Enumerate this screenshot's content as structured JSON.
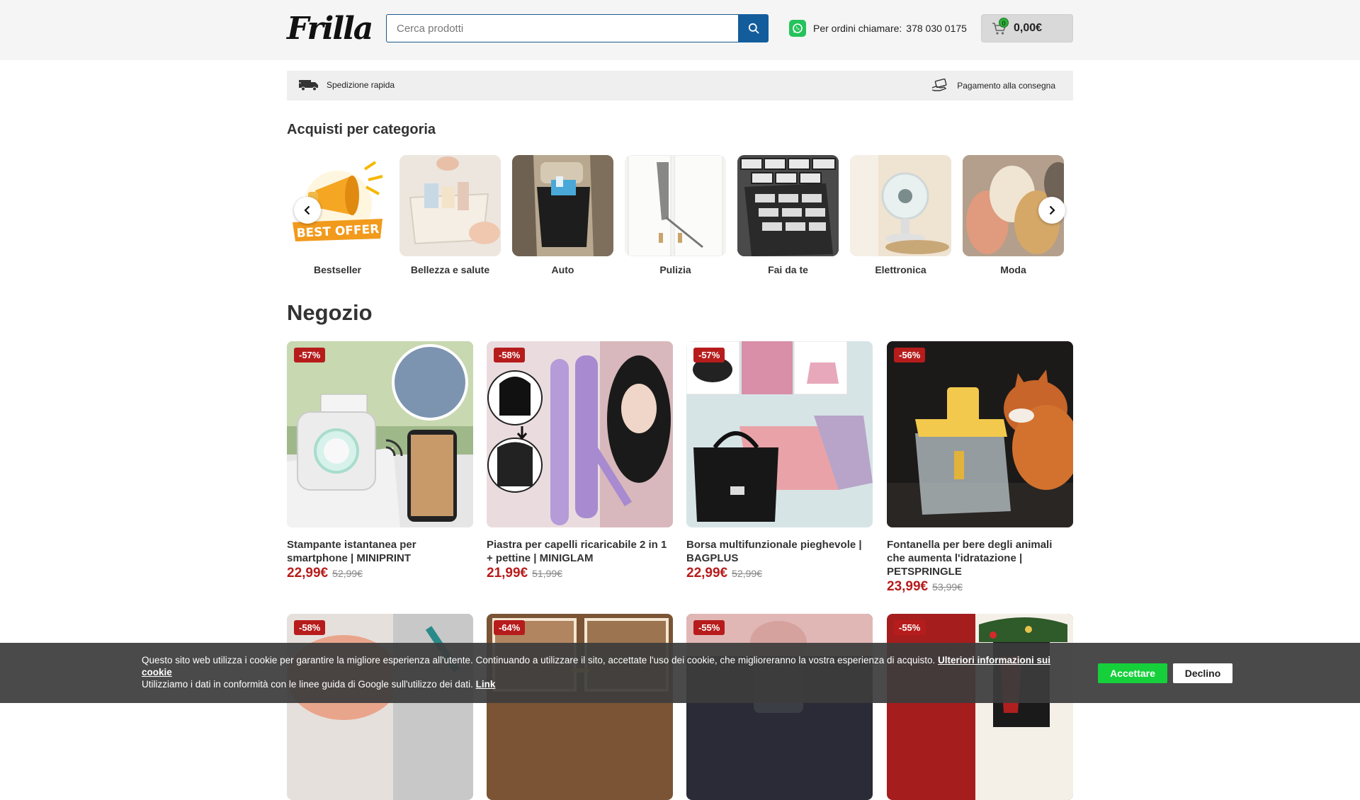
{
  "header": {
    "logo": "Frilla",
    "search_placeholder": "Cerca prodotti",
    "phone_label": "Per ordini chiamare:",
    "phone_number": "378 030 0175",
    "cart_count": "0",
    "cart_total": "0,00€"
  },
  "infobar": {
    "shipping": "Spedizione rapida",
    "payment": "Pagamento alla consegna"
  },
  "categories": {
    "title": "Acquisti per categoria",
    "items": [
      {
        "label": "Bestseller",
        "badge": "BEST OFFER"
      },
      {
        "label": "Bellezza e salute"
      },
      {
        "label": "Auto"
      },
      {
        "label": "Pulizia"
      },
      {
        "label": "Fai da te"
      },
      {
        "label": "Elettronica"
      },
      {
        "label": "Moda"
      }
    ]
  },
  "shop": {
    "title": "Negozio",
    "products": [
      {
        "discount": "-57%",
        "name": "Stampante istantanea per smartphone | MINIPRINT",
        "price": "22,99€",
        "old_price": "52,99€"
      },
      {
        "discount": "-58%",
        "name": "Piastra per capelli ricaricabile 2 in 1 + pettine | MINIGLAM",
        "price": "21,99€",
        "old_price": "51,99€"
      },
      {
        "discount": "-57%",
        "name": "Borsa multifunzionale pieghevole | BAGPLUS",
        "price": "22,99€",
        "old_price": "52,99€"
      },
      {
        "discount": "-56%",
        "name": "Fontanella per bere degli animali che aumenta l'idratazione | PETSPRINGLE",
        "price": "23,99€",
        "old_price": "53,99€"
      },
      {
        "discount": "-58%"
      },
      {
        "discount": "-64%"
      },
      {
        "discount": "-55%"
      },
      {
        "discount": "-55%"
      }
    ]
  },
  "cookie": {
    "text1": "Questo sito web utilizza i cookie per garantire la migliore esperienza all'utente. Continuando a utilizzare il sito, accettate l'uso dei cookie, che miglioreranno la vostra esperienza di acquisto.",
    "more_link": "Ulteriori informazioni sui cookie",
    "text2": "Utilizziamo i dati in conformità con le linee guida di Google sull'utilizzo dei dati.",
    "link": "Link",
    "accept": "Accettare",
    "decline": "Declino"
  },
  "colors": {
    "brand_blue": "#145d9d",
    "price_red": "#b71c1c",
    "accept_green": "#15d03a",
    "whatsapp_green": "#25c35b"
  }
}
